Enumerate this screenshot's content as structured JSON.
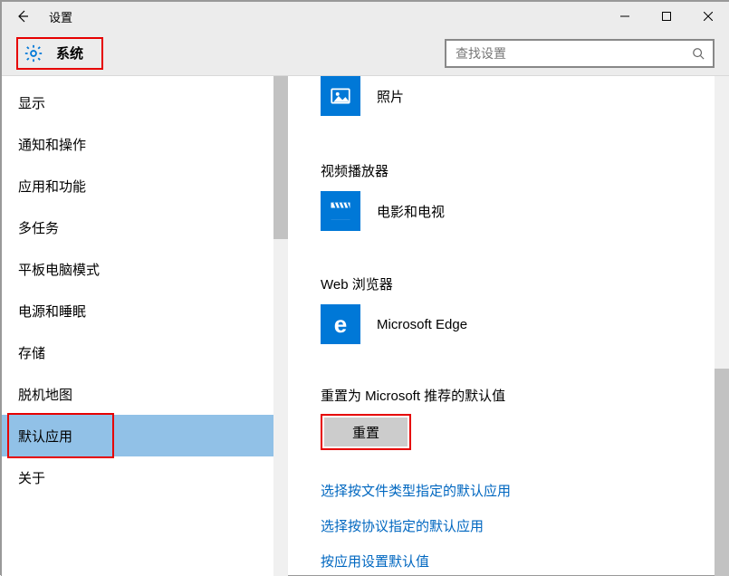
{
  "window": {
    "title": "设置"
  },
  "header": {
    "system_label": "系统",
    "search_placeholder": "查找设置"
  },
  "sidebar": {
    "items": [
      {
        "label": "显示"
      },
      {
        "label": "通知和操作"
      },
      {
        "label": "应用和功能"
      },
      {
        "label": "多任务"
      },
      {
        "label": "平板电脑模式"
      },
      {
        "label": "电源和睡眠"
      },
      {
        "label": "存储"
      },
      {
        "label": "脱机地图"
      },
      {
        "label": "默认应用"
      },
      {
        "label": "关于"
      }
    ],
    "selected_index": 8
  },
  "content": {
    "sections": [
      {
        "heading": "",
        "app_name": "照片",
        "icon": "photos"
      },
      {
        "heading": "视频播放器",
        "app_name": "电影和电视",
        "icon": "movies"
      },
      {
        "heading": "Web 浏览器",
        "app_name": "Microsoft Edge",
        "icon": "edge"
      }
    ],
    "reset_heading": "重置为 Microsoft 推荐的默认值",
    "reset_button": "重置",
    "links": [
      "选择按文件类型指定的默认应用",
      "选择按协议指定的默认应用",
      "按应用设置默认值"
    ]
  }
}
